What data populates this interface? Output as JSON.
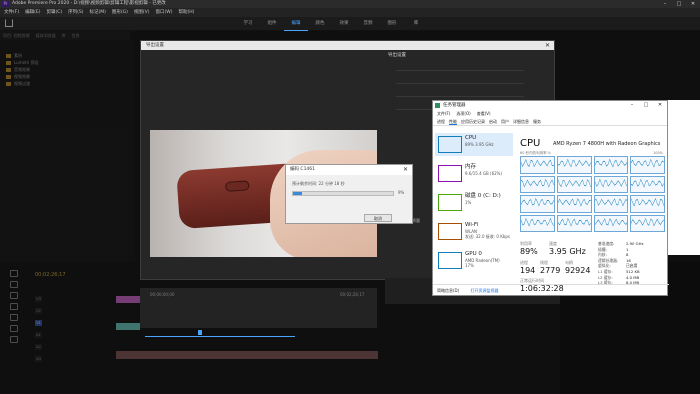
{
  "app": {
    "title": "Adobe Premiere Pro 2020 - D:\\视频\\视频剪辑\\剪辑工程\\影视剪辑 - 已更改",
    "logo": "Pr",
    "menu": [
      "文件(F)",
      "编辑(E)",
      "剪辑(C)",
      "序列(S)",
      "标记(M)",
      "图形(G)",
      "视图(V)",
      "窗口(W)",
      "帮助(H)"
    ],
    "workspaces": [
      "学习",
      "组件",
      "编辑",
      "颜色",
      "效果",
      "音频",
      "图形",
      "库"
    ],
    "active_workspace": "编辑"
  },
  "project": {
    "tabs": [
      "项目: 视频剪辑",
      "媒体浏览器",
      "库",
      "信息"
    ],
    "items": [
      "素材",
      "Lumetri 预设",
      "音频效果",
      "视频效果",
      "视频过渡"
    ]
  },
  "timeline": {
    "timecode": "00;02;26;17",
    "tracks": [
      "V3",
      "V2",
      "V1",
      "A1",
      "A2",
      "A3"
    ],
    "active_track": "V1"
  },
  "export_dialog": {
    "title": "导出设置",
    "right_title": "导出设置",
    "queue_label": "使用最高渲染质量",
    "timecode_in": "00;00;00;00",
    "timecode_out": "00;02;26;17"
  },
  "encoding_dialog": {
    "title": "编码 C1461",
    "message": "预计剩余时间: 22 分钟 18 秒",
    "progress": 0.09,
    "percent_label": "9%",
    "cancel_label": "取消"
  },
  "task_manager": {
    "title": "任务管理器",
    "menu": [
      "文件(F)",
      "选项(O)",
      "查看(V)"
    ],
    "tabs": [
      "进程",
      "性能",
      "应用历史记录",
      "启动",
      "用户",
      "详细信息",
      "服务"
    ],
    "active_tab": "性能",
    "sidebar": [
      {
        "name": "CPU",
        "detail": "89% 3.95 GHz",
        "color": "#117dbb"
      },
      {
        "name": "内存",
        "detail": "9.6/15.4 GB (62%)",
        "color": "#8b12ae"
      },
      {
        "name": "磁盘 0 (C: D:)",
        "detail": "1%",
        "color": "#4da60c"
      },
      {
        "name": "Wi-Fi",
        "detail": "WLAN\n发送: 32.0 接收: 0 Kbps",
        "color": "#a74f01"
      },
      {
        "name": "GPU 0",
        "detail": "AMD Radeon(TM)\n17%",
        "color": "#117dbb"
      }
    ],
    "cpu_header": "CPU",
    "cpu_model": "AMD Ryzen 7 4800H with Radeon Graphics",
    "util_caption": "60 秒内的利用率 %",
    "util_max": "100%",
    "utilization": {
      "label": "利用率",
      "value": "89%"
    },
    "speed": {
      "label": "速度",
      "value": "3.95 GHz"
    },
    "processes": {
      "label": "进程",
      "value": "194"
    },
    "threads": {
      "label": "线程",
      "value": "2779"
    },
    "handles": {
      "label": "句柄",
      "value": "92924"
    },
    "uptime": {
      "label": "正常运行时间",
      "value": "1:06:32:28"
    },
    "specs": [
      {
        "k": "基准速度:",
        "v": "2.90 GHz"
      },
      {
        "k": "插槽:",
        "v": "1"
      },
      {
        "k": "内核:",
        "v": "8"
      },
      {
        "k": "逻辑处理器:",
        "v": "16"
      },
      {
        "k": "虚拟化:",
        "v": "已启用"
      },
      {
        "k": "L1 缓存:",
        "v": "512 KB"
      },
      {
        "k": "L2 缓存:",
        "v": "4.0 MB"
      },
      {
        "k": "L3 缓存:",
        "v": "8.0 MB"
      }
    ],
    "footer_less": "简略信息(D)",
    "footer_link": "打开资源监视器"
  }
}
